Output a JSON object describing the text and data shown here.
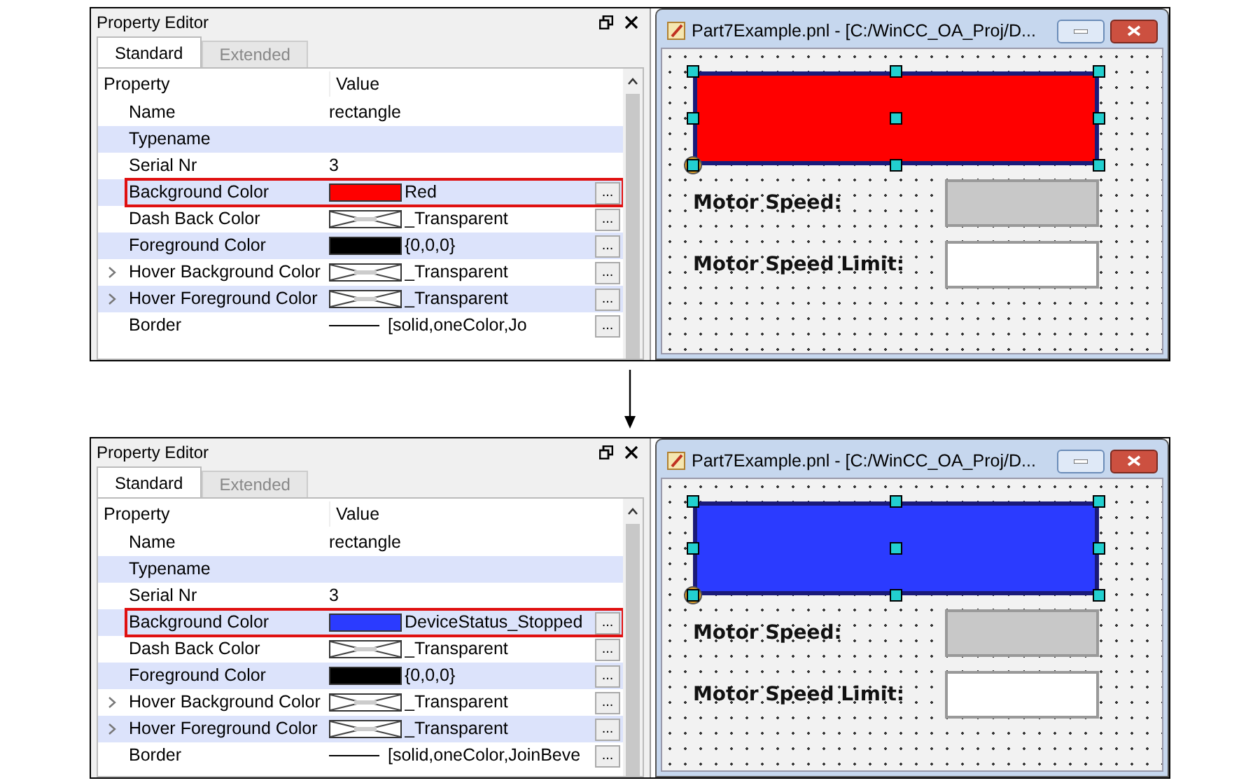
{
  "panels": [
    {
      "property_editor": {
        "title": "Property Editor",
        "tabs": [
          {
            "label": "Standard",
            "selected": true
          },
          {
            "label": "Extended",
            "selected": false
          }
        ],
        "columns": [
          "Property",
          "Value"
        ],
        "rows": [
          {
            "kind": "text",
            "label": "Name",
            "value": "rectangle",
            "expandable": false,
            "outlined": false
          },
          {
            "kind": "text",
            "label": "Typename",
            "expandable": false,
            "outlined": false
          },
          {
            "kind": "text",
            "label": "Serial Nr",
            "value": "3",
            "expandable": false,
            "outlined": false
          },
          {
            "kind": "color",
            "label": "Background Color",
            "color": "#ff0000",
            "value": "Red",
            "button": "...",
            "expandable": false,
            "outlined": true
          },
          {
            "kind": "pattern",
            "label": "Dash Back Color",
            "value": "_Transparent",
            "button": "...",
            "expandable": false,
            "outlined": false
          },
          {
            "kind": "color",
            "label": "Foreground Color",
            "color": "#000000",
            "value": "{0,0,0}",
            "button": "...",
            "expandable": false,
            "outlined": false
          },
          {
            "kind": "pattern",
            "label": "Hover Background Color",
            "value": "_Transparent",
            "button": "...",
            "expandable": true,
            "outlined": false
          },
          {
            "kind": "pattern",
            "label": "Hover Foreground Color",
            "value": "_Transparent",
            "button": "...",
            "expandable": true,
            "outlined": false
          },
          {
            "kind": "line",
            "label": "Border",
            "value": "[solid,oneColor,Jo",
            "button": "...",
            "expandable": false,
            "outlined": false
          }
        ]
      },
      "window": {
        "title": "Part7Example.pnl - [C:/WinCC_OA_Proj/D...",
        "color": "#ff0000",
        "fields": [
          {
            "label": "Motor Speed:",
            "disabled": true
          },
          {
            "label": "Motor Speed Limit:",
            "disabled": false
          }
        ]
      }
    },
    {
      "property_editor": {
        "title": "Property Editor",
        "tabs": [
          {
            "label": "Standard",
            "selected": true
          },
          {
            "label": "Extended",
            "selected": false
          }
        ],
        "columns": [
          "Property",
          "Value"
        ],
        "rows": [
          {
            "kind": "text",
            "label": "Name",
            "value": "rectangle",
            "expandable": false,
            "outlined": false
          },
          {
            "kind": "text",
            "label": "Typename",
            "expandable": false,
            "outlined": false
          },
          {
            "kind": "text",
            "label": "Serial Nr",
            "value": "3",
            "expandable": false,
            "outlined": false
          },
          {
            "kind": "color",
            "label": "Background Color",
            "color": "#2b3bff",
            "value": "DeviceStatus_Stopped",
            "button": "...",
            "expandable": false,
            "outlined": true
          },
          {
            "kind": "pattern",
            "label": "Dash Back Color",
            "value": "_Transparent",
            "button": "...",
            "expandable": false,
            "outlined": false
          },
          {
            "kind": "color",
            "label": "Foreground Color",
            "color": "#000000",
            "value": "{0,0,0}",
            "button": "...",
            "expandable": false,
            "outlined": false
          },
          {
            "kind": "pattern",
            "label": "Hover Background Color",
            "value": "_Transparent",
            "button": "...",
            "expandable": true,
            "outlined": false
          },
          {
            "kind": "pattern",
            "label": "Hover Foreground Color",
            "value": "_Transparent",
            "button": "...",
            "expandable": true,
            "outlined": false
          },
          {
            "kind": "line",
            "label": "Border",
            "value": "[solid,oneColor,JoinBeve",
            "button": "...",
            "expandable": false,
            "outlined": false
          }
        ]
      },
      "window": {
        "title": "Part7Example.pnl - [C:/WinCC_OA_Proj/D...",
        "color": "#2b3bff",
        "fields": [
          {
            "label": "Motor Speed:",
            "disabled": true
          },
          {
            "label": "Motor Speed Limit:",
            "disabled": false
          }
        ]
      }
    }
  ]
}
